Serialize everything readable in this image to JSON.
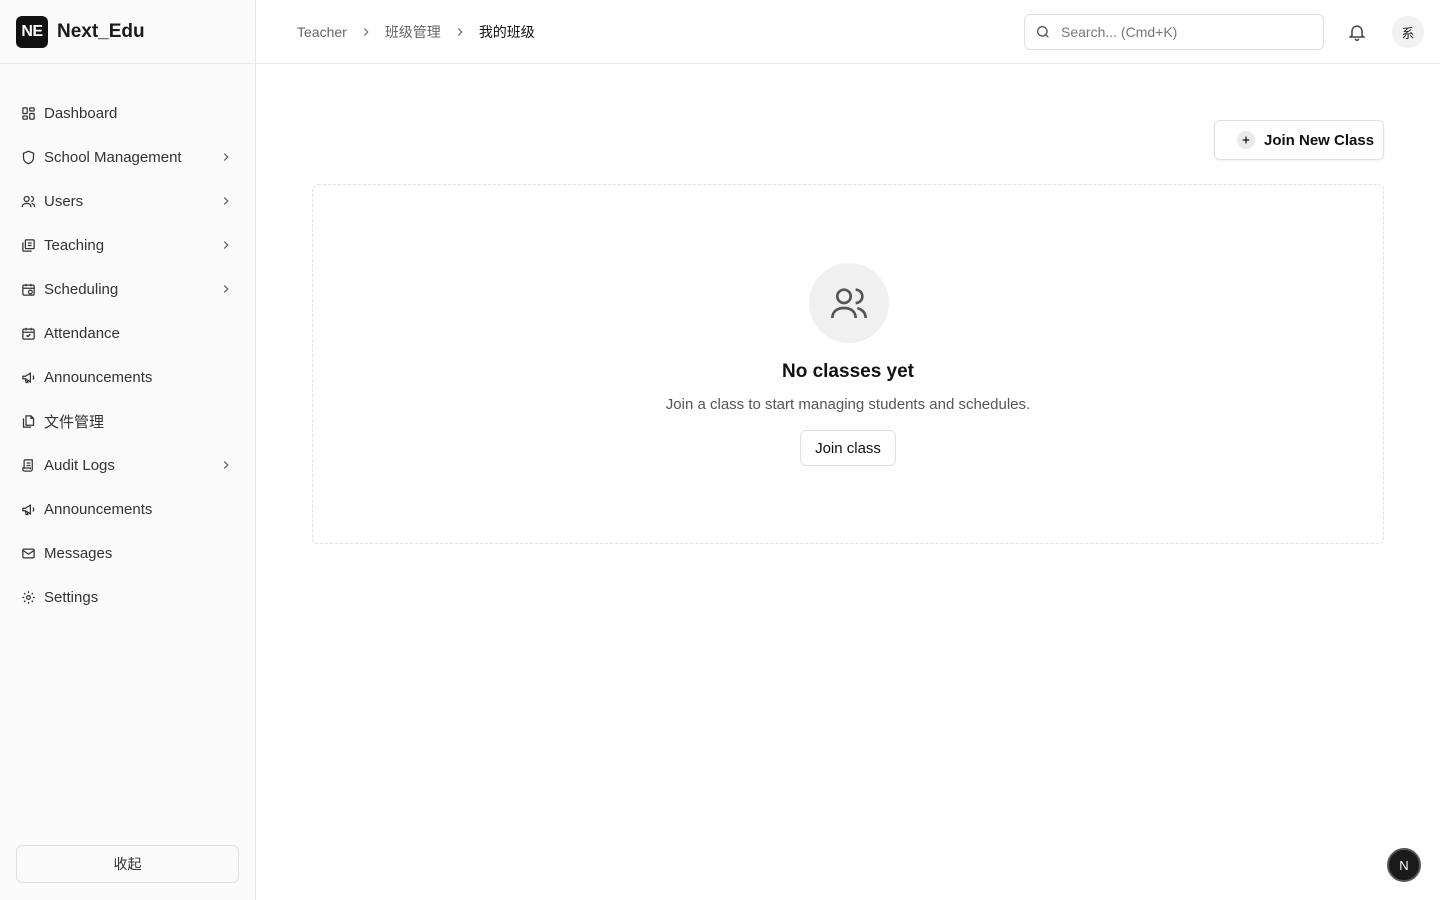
{
  "brand": {
    "logo_text": "NE",
    "name": "Next_Edu"
  },
  "sidebar": {
    "items": [
      {
        "label": "Dashboard",
        "icon": "dashboard-icon",
        "expandable": false
      },
      {
        "label": "School Management",
        "icon": "shield-icon",
        "expandable": true
      },
      {
        "label": "Users",
        "icon": "users-icon",
        "expandable": true
      },
      {
        "label": "Teaching",
        "icon": "book-icon",
        "expandable": true
      },
      {
        "label": "Scheduling",
        "icon": "calendar-clock-icon",
        "expandable": true
      },
      {
        "label": "Attendance",
        "icon": "calendar-check-icon",
        "expandable": false
      },
      {
        "label": "Announcements",
        "icon": "megaphone-icon",
        "expandable": false
      },
      {
        "label": "文件管理",
        "icon": "files-icon",
        "expandable": false
      },
      {
        "label": "Audit Logs",
        "icon": "scroll-icon",
        "expandable": true
      },
      {
        "label": "Announcements",
        "icon": "megaphone-icon",
        "expandable": false
      },
      {
        "label": "Messages",
        "icon": "mail-icon",
        "expandable": false
      },
      {
        "label": "Settings",
        "icon": "gear-icon",
        "expandable": false
      }
    ],
    "collapse_label": "收起"
  },
  "header": {
    "breadcrumb": [
      "Teacher",
      "班级管理",
      "我的班级"
    ],
    "search_placeholder": "Search... (Cmd+K)",
    "avatar_text": "系"
  },
  "main": {
    "join_new_label": "Join New Class",
    "empty": {
      "title": "No classes yet",
      "description": "Join a class to start managing students and schedules.",
      "button_label": "Join class"
    }
  },
  "floating_badge": "N"
}
